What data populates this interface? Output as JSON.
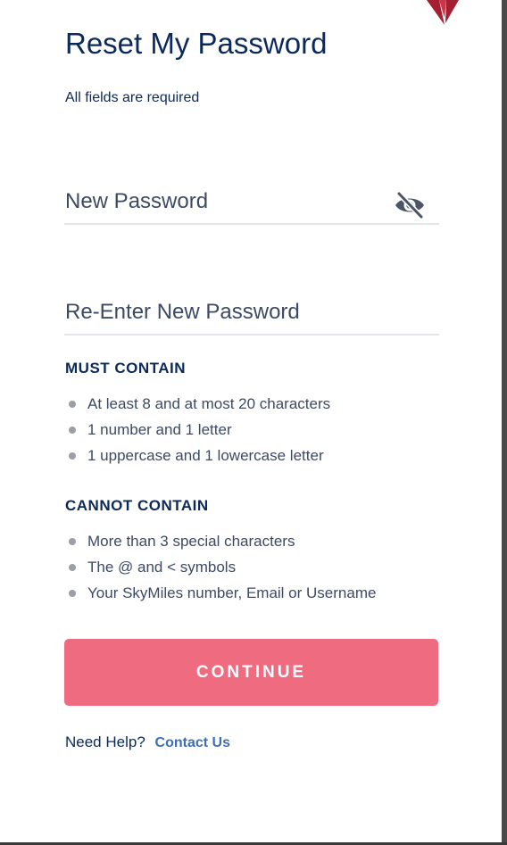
{
  "header": {
    "title": "Reset My Password",
    "subtitle": "All fields are required"
  },
  "fields": {
    "new_password": {
      "label": "New Password",
      "toggle_icon": "eye-slash-icon"
    },
    "reenter_password": {
      "label": "Re-Enter New Password"
    }
  },
  "requirements": {
    "must_heading": "MUST CONTAIN",
    "must_items": [
      "At least 8 and at most 20 characters",
      "1 number and 1 letter",
      "1 uppercase and 1 lowercase letter"
    ],
    "cannot_heading": "CANNOT CONTAIN",
    "cannot_items": [
      "More than 3 special characters",
      "The @ and < symbols",
      "Your SkyMiles number, Email or Username"
    ]
  },
  "actions": {
    "continue_label": "CONTINUE"
  },
  "help": {
    "text": "Need Help?",
    "link_label": "Contact Us"
  },
  "colors": {
    "primary_text": "#0b2a5b",
    "field_label": "#3c4a66",
    "button_bg": "#ef6b80",
    "link": "#3d6fb5",
    "logo": "#a51f32"
  }
}
